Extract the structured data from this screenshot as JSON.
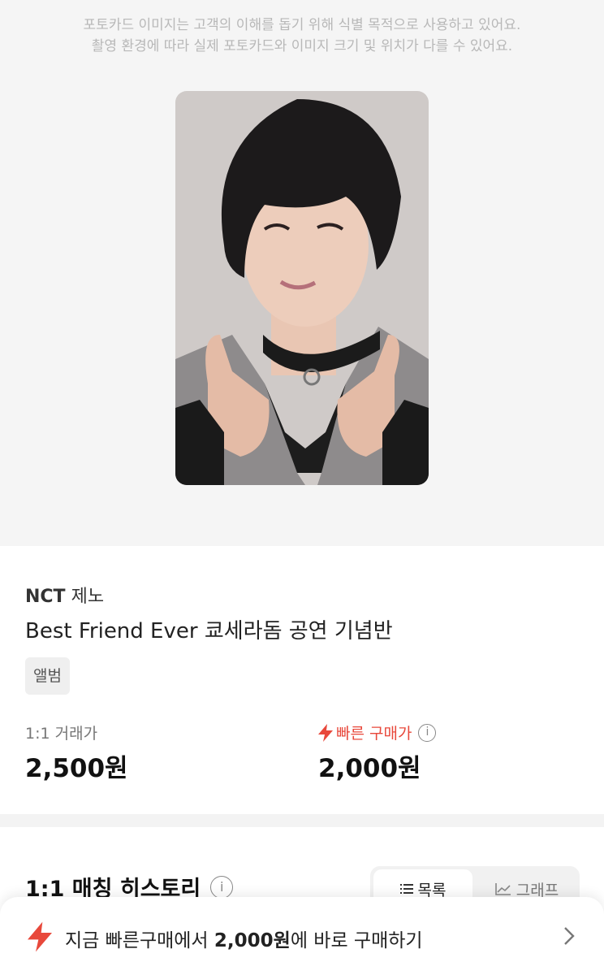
{
  "hero": {
    "notice_line1": "포토카드 이미지는 고객의 이해를 돕기 위해 식별 목적으로 사용하고 있어요.",
    "notice_line2": "촬영 환경에 따라 실제 포토카드와 이미지 크기 및 위치가 다를 수 있어요."
  },
  "product": {
    "group": "NCT",
    "member": "제노",
    "title": "Best Friend Ever 쿄세라돔 공연 기념반",
    "tag": "앨범"
  },
  "prices": {
    "trade_label": "1:1 거래가",
    "trade_value": "2,500원",
    "fast_label": "빠른 구매가",
    "fast_value": "2,000원",
    "fast_color": "#e8483b"
  },
  "history": {
    "title": "1:1 매칭 히스토리",
    "tabs": [
      "목록",
      "그래프"
    ]
  },
  "bottom_bar": {
    "text_prefix": "지금 빠른구매에서 ",
    "price": "2,000원",
    "text_suffix": "에 바로 구매하기"
  },
  "icons": {
    "info": "i",
    "bolt": "lightning-bolt-icon",
    "list": "list-icon",
    "graph": "line-chart-icon",
    "chevron": "chevron-right-icon"
  }
}
